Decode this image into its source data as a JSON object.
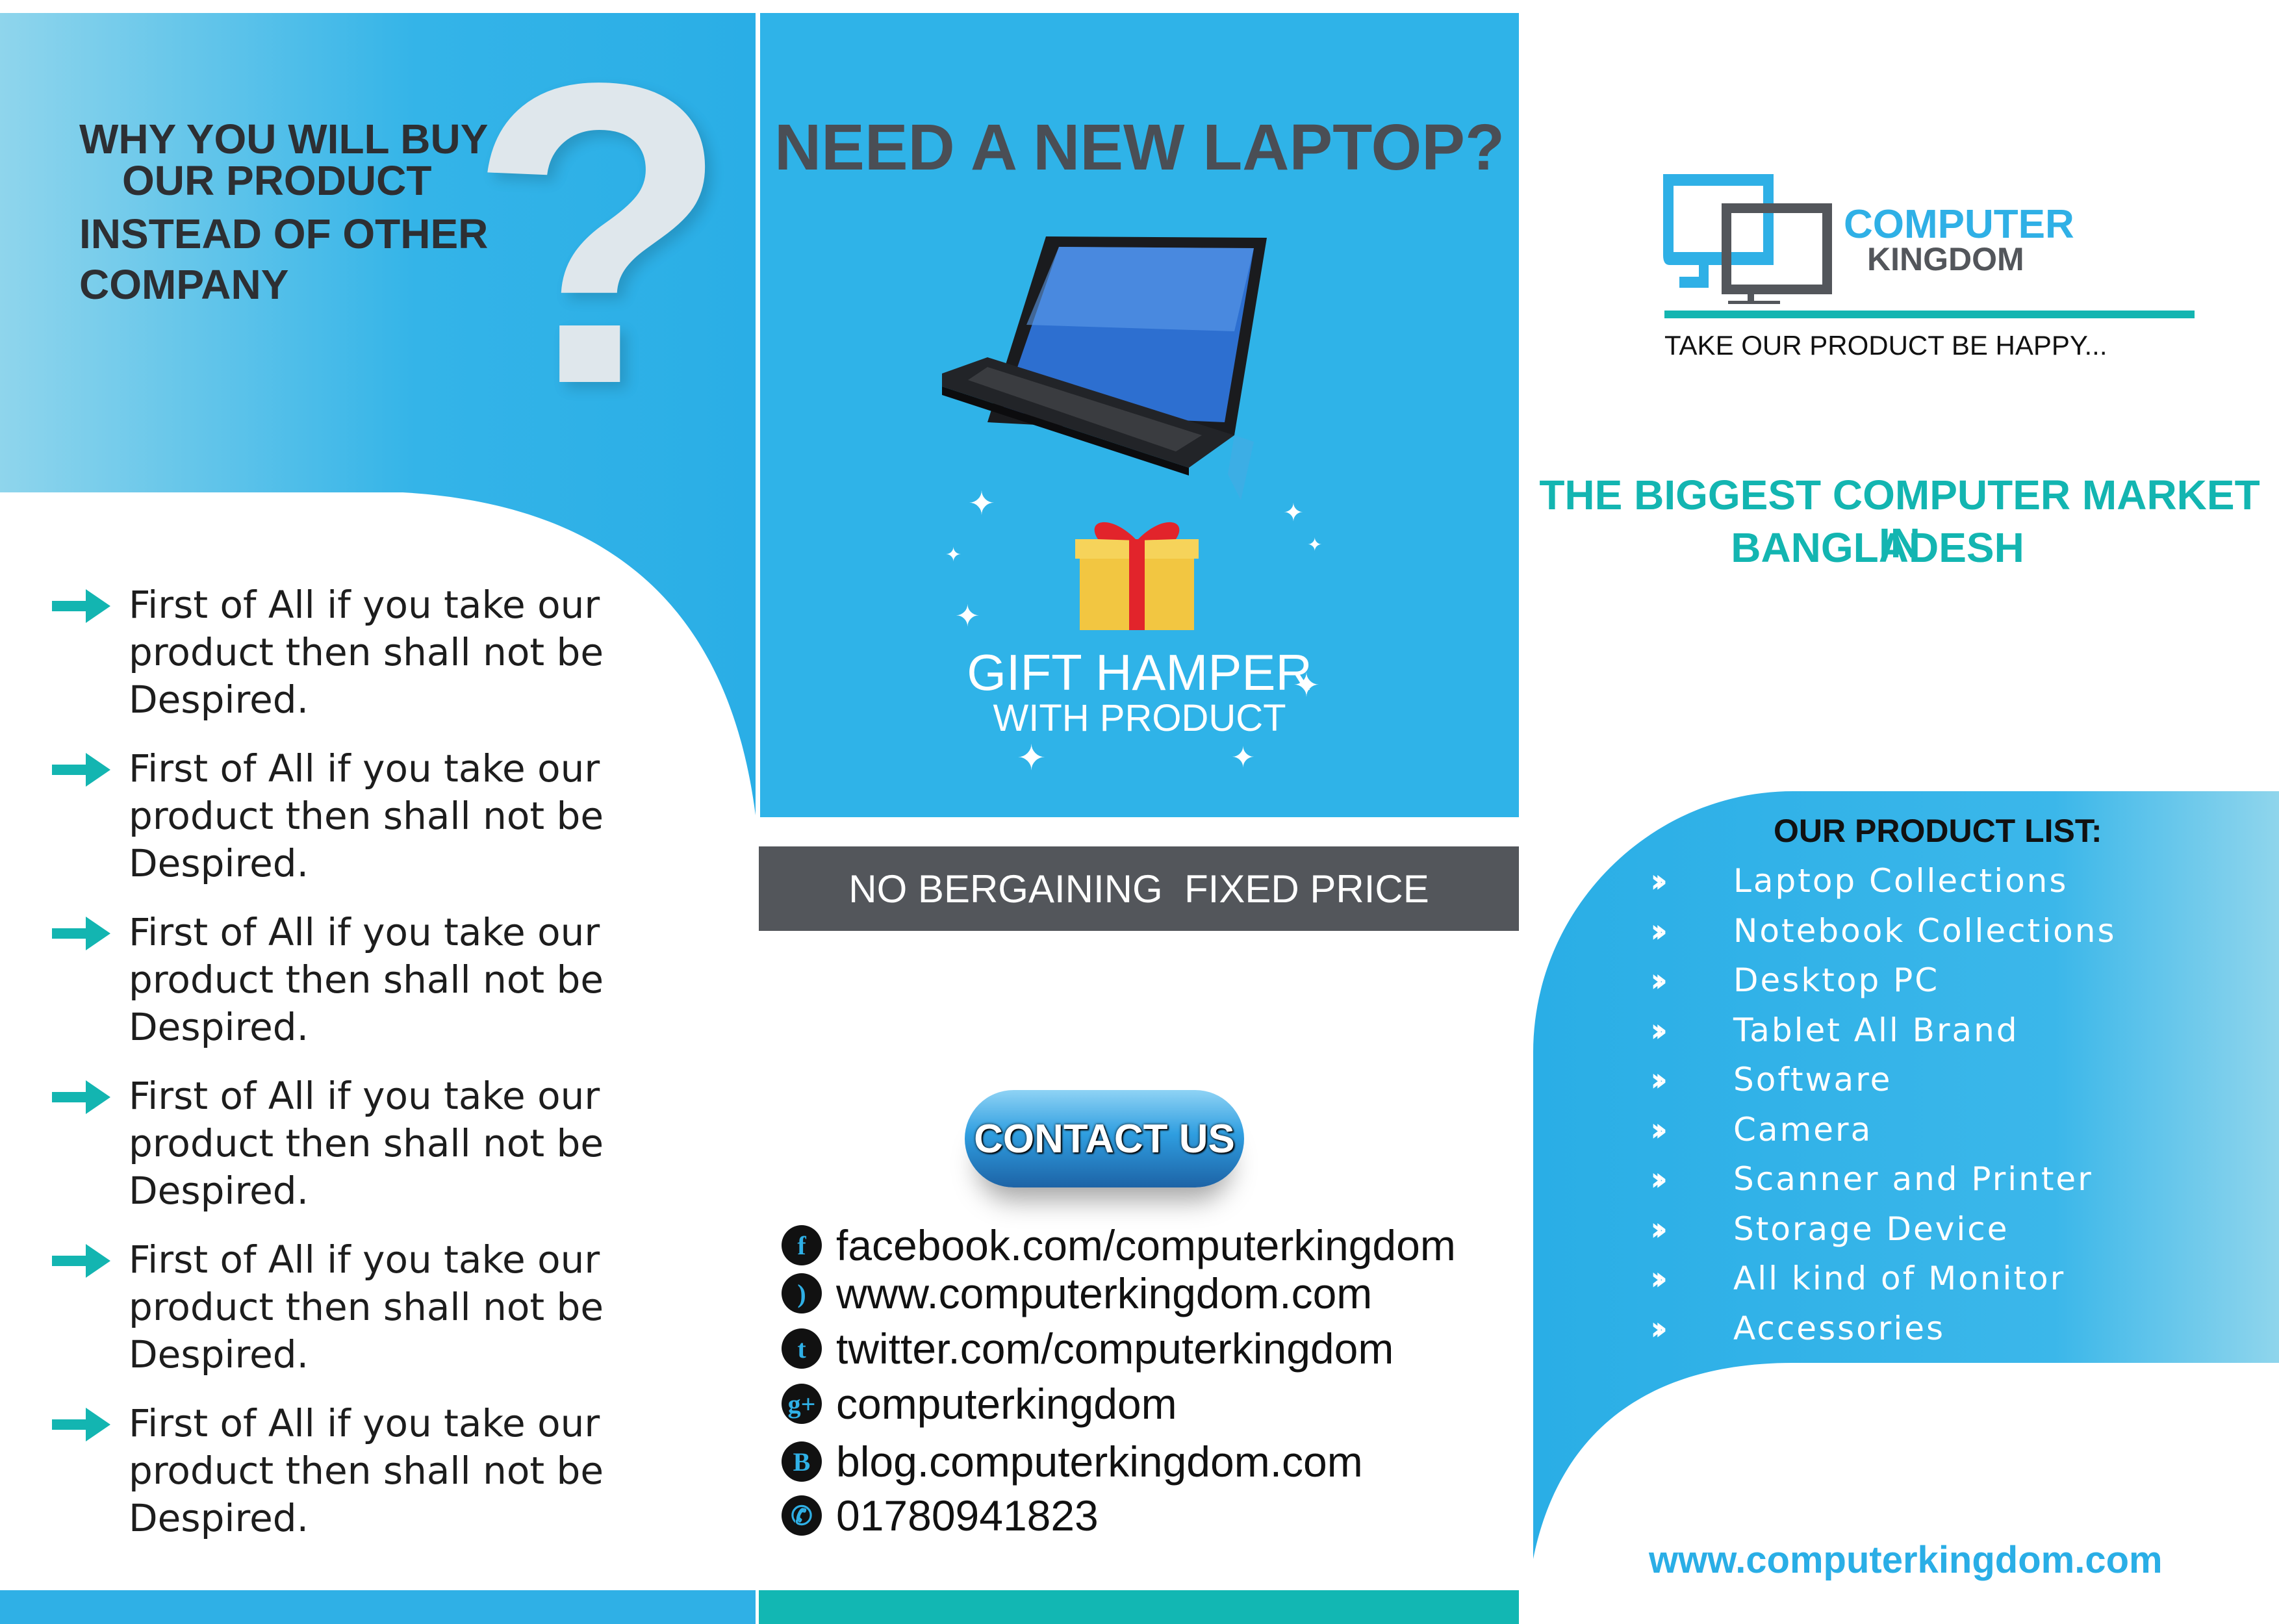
{
  "left": {
    "heading": [
      "WHY YOU WILL BUY",
      "OUR PRODUCT",
      "INSTEAD OF OTHER",
      "COMPANY"
    ],
    "question_mark": "?",
    "items": [
      "First of All if you take our product then shall not be Despired.",
      "First of All if you take our product then shall not be Despired.",
      "First of All if you take our product then shall not be Despired.",
      "First of All if you take our product then shall not be Despired.",
      "First of All if you take our product then shall not be Despired.",
      "First of All if you take our product then shall not be Despired."
    ]
  },
  "middle": {
    "headline": "NEED A NEW LAPTOP?",
    "gift_title": "GIFT HAMPER",
    "gift_sub": "WITH PRODUCT",
    "price_bar": "NO BERGAINING  FIXED PRICE",
    "contact_button": "CONTACT US",
    "contacts": [
      {
        "icon": "facebook-icon",
        "text": "facebook.com/computerkingdom"
      },
      {
        "icon": "rss-icon",
        "text": "www.computerkingdom.com"
      },
      {
        "icon": "twitter-icon",
        "text": "twitter.com/computerkingdom"
      },
      {
        "icon": "google-plus-icon",
        "text": "computerkingdom"
      },
      {
        "icon": "blogger-icon",
        "text": "blog.computerkingdom.com"
      },
      {
        "icon": "phone-icon",
        "text": "01780941823"
      }
    ]
  },
  "right": {
    "logo_line1": "COMPUTER",
    "logo_line2": "KINGDOM",
    "tagline": "TAKE OUR PRODUCT BE HAPPY...",
    "market_heading": [
      "THE BIGGEST COMPUTER MARKET IN",
      "BANGLADESH"
    ],
    "product_list_title": "OUR PRODUCT LIST:",
    "products": [
      "Laptop Collections",
      "Notebook Collections",
      "Desktop PC",
      "Tablet All Brand",
      "Software",
      "Camera",
      "Scanner and Printer",
      "Storage Device",
      "All kind of Monitor",
      "Accessories"
    ],
    "website": "www.computerkingdom.com"
  },
  "colors": {
    "blue": "#2fb2e8",
    "teal": "#13b5b1",
    "gray": "#53565b",
    "dark": "#4a4e55"
  }
}
